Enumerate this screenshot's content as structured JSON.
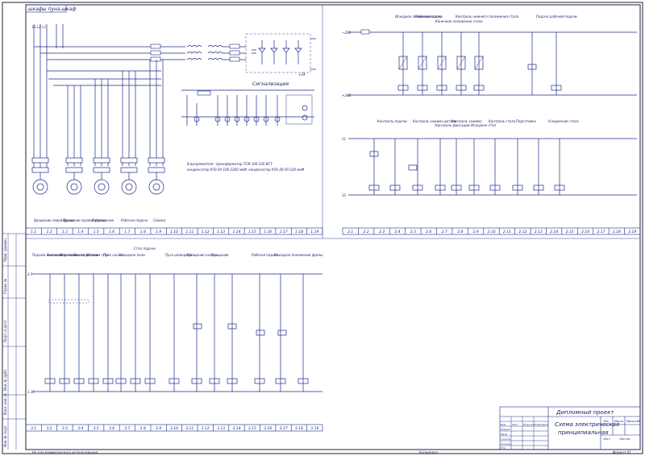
{
  "header": {
    "title": "шкафы пуна.шкаф"
  },
  "sections": {
    "signal": "Сигнализация",
    "right_top_labels": [
      "Исходное положение стола",
      "Рабочая подача",
      "Конечное положение стола",
      "Контроль нижнего положения стола",
      "Подача рабочей подачи"
    ],
    "right_mid_labels": [
      "Контроль подачи",
      "Контроль зажима детали",
      "Контроль фиксации",
      "Контроль зажима",
      "Исходное стол",
      "Контроль стола",
      "Подготовка",
      "Ускоренная стола"
    ],
    "left_bottom_labels": [
      "Подъём вилочного",
      "Зажим вилочного",
      "Опускание стола",
      "Зажим детали",
      "Разжим стол",
      "Пуск насоса",
      "Исходное поло.",
      "Стоп подачи",
      "Пуск шпинделя",
      "Вращение насоса",
      "Вращение",
      "Рабочая подача",
      "Исходное положение фрезы"
    ],
    "motor_labels": [
      "Вращение левой фрезы",
      "Вращение правой фрезы",
      "Охлаждение",
      "Рабочая подача",
      "Смазка"
    ],
    "note_lines": [
      "В выпрямителе: трансформатор ТСМ 100-220 ВСТ",
      "конденсатор К50-20-100-2200 мкФ, конденсатор К50-20-50-220 мкФ"
    ]
  },
  "zones_top_left": [
    "1.1",
    "1.2",
    "1.3",
    "1.4",
    "1.5",
    "1.6",
    "1.7",
    "1.8",
    "1.9",
    "1.10",
    "1.11",
    "1.12",
    "1.13",
    "1.14",
    "1.15",
    "1.16",
    "1.17",
    "1.18",
    "1.19"
  ],
  "zones_top_right": [
    "2.1",
    "2.2",
    "2.3",
    "2.4",
    "2.5",
    "2.6",
    "2.7",
    "2.8",
    "2.9",
    "2.10",
    "2.11",
    "2.12",
    "2.13",
    "2.14",
    "2.15",
    "2.16",
    "2.17",
    "2.18",
    "2.19"
  ],
  "zones_bottom": [
    "3.1",
    "3.2",
    "3.3",
    "3.4",
    "3.5",
    "3.6",
    "3.7",
    "3.8",
    "3.9",
    "3.10",
    "3.11",
    "3.12",
    "3.13",
    "3.14",
    "3.15",
    "3.16",
    "3.17",
    "3.18",
    "3.19"
  ],
  "bus_labels": {
    "l1": "~380",
    "l2": "+24В",
    "l3": "−24В",
    "top_right": "~220"
  },
  "title_block": {
    "project": "Дипломный проект",
    "name1": "Схема электрическая",
    "name2": "принципиальная",
    "lit": "Лит.",
    "mass": "Масса",
    "scale": "Масштаб",
    "sheet": "Лист",
    "sheets": "Листов",
    "rows": [
      "Изм.",
      "Лист",
      "№ докум.",
      "Подп.",
      "Дата",
      "Разраб.",
      "Пров.",
      "Т.контр.",
      "Н.контр.",
      "Утв."
    ]
  },
  "footer": {
    "left": "Не для коммерческого использования",
    "mid": "Копировал",
    "right": "Формат А1"
  },
  "side_stamp": [
    "Перв. примен.",
    "Справ. №",
    "Подп. и дата",
    "Инв. № дубл.",
    "Взам. инв. №",
    "Подп. и дата",
    "Инв. № подл."
  ]
}
